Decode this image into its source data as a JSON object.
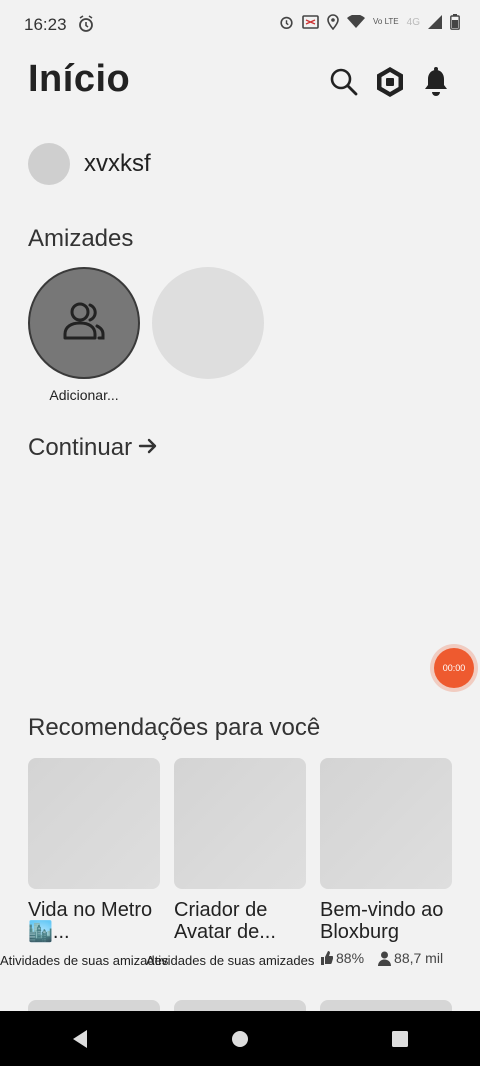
{
  "status_bar": {
    "time": "16:23",
    "volte": "Vo LTE",
    "network": "4G"
  },
  "header": {
    "title": "Início"
  },
  "profile": {
    "username": "xvxksf"
  },
  "friends": {
    "title": "Amizades",
    "add_label": "Adicionar..."
  },
  "continue": {
    "title": "Continuar"
  },
  "recording": {
    "timer": "00:00"
  },
  "recommendations": {
    "title": "Recomendações para você",
    "cards": [
      {
        "name": "Vida no Metro 🏙️...",
        "subtitle": "Atividades de suas amizades"
      },
      {
        "name": "Criador de Avatar de...",
        "subtitle": "Atividades de suas amizades"
      },
      {
        "name": "Bem-vindo ao Bloxburg",
        "rating": "88%",
        "players": "88,7 mil"
      }
    ]
  },
  "colors": {
    "background": "#f2f2f2",
    "recording_accent": "#ee5a2f",
    "nav_bar": "#000000"
  },
  "icons": [
    "alarm-icon",
    "wifi-icon",
    "signal-icon",
    "battery-icon",
    "location-icon",
    "cast-icon",
    "search-icon",
    "robux-icon",
    "bell-icon",
    "friends-icon",
    "arrow-right-icon",
    "thumbs-up-icon",
    "person-icon",
    "back-icon",
    "home-icon",
    "recents-icon"
  ]
}
